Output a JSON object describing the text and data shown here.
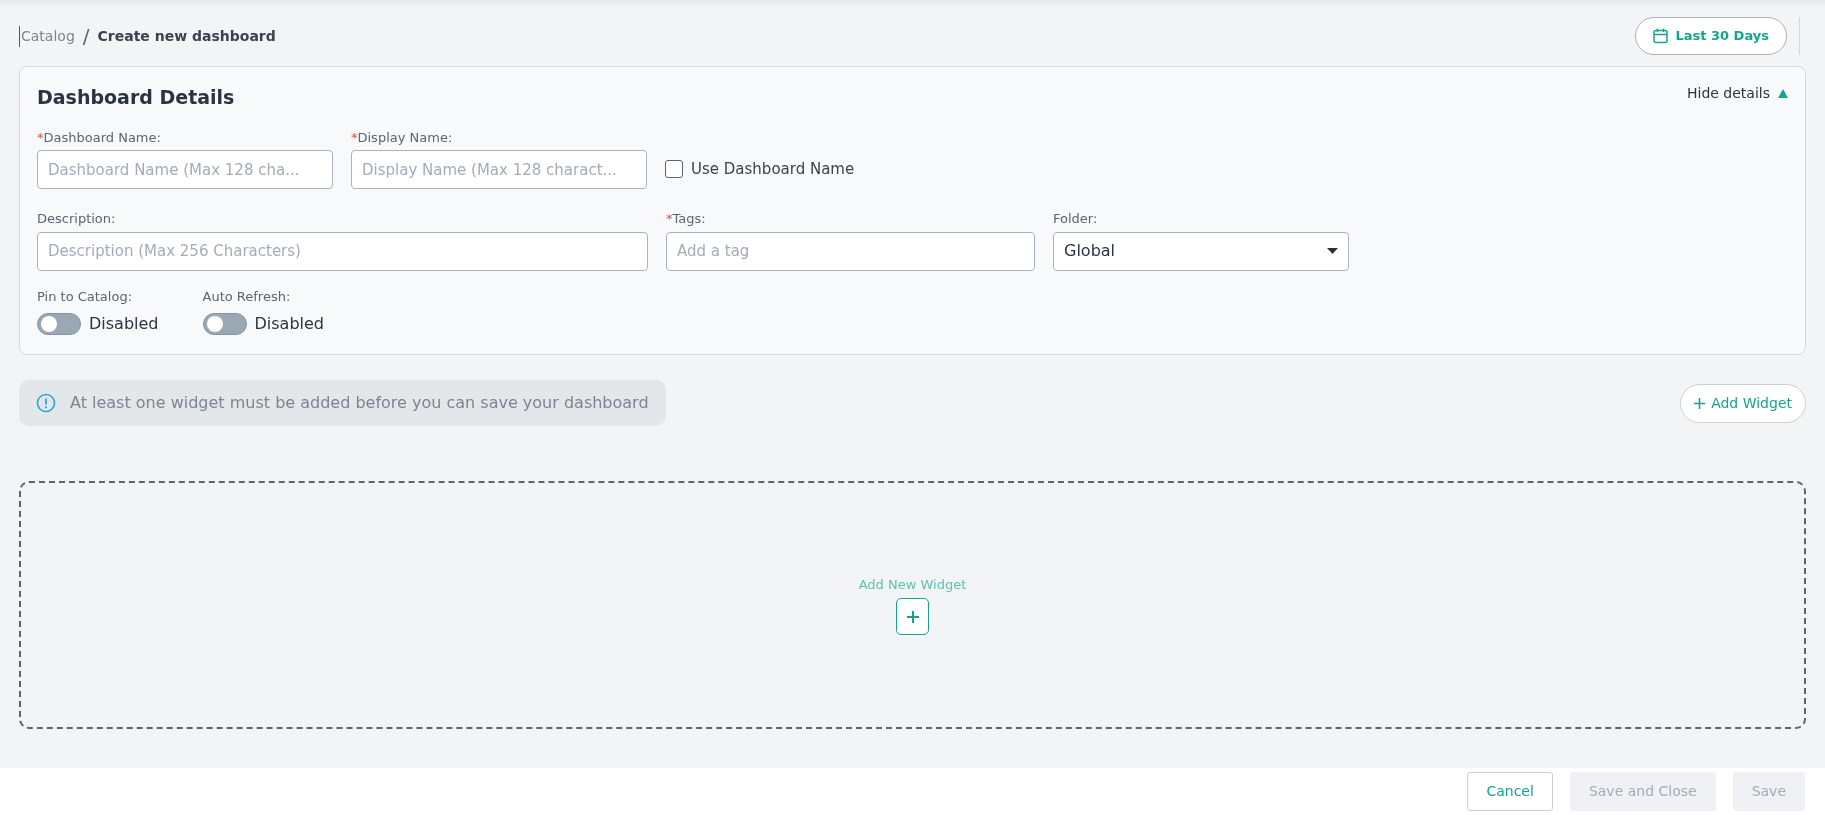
{
  "breadcrumb": [
    {
      "label": "Catalog",
      "current": false
    },
    {
      "label": "Create new dashboard",
      "current": true
    }
  ],
  "breadcrumb_separator": "/",
  "date_range": {
    "label": "Last 30 Days"
  },
  "details": {
    "title": "Dashboard Details",
    "toggle_label": "Hide details",
    "expanded": true,
    "fields": [
      {
        "kind": "input",
        "required_mark": "*",
        "label": "Dashboard Name:",
        "placeholder": "Dashboard Name (Max 128 cha..."
      },
      {
        "kind": "input",
        "required_mark": "*",
        "label": "Display Name:",
        "placeholder": "Display Name (Max 128 charact..."
      },
      {
        "kind": "checkbox",
        "label": "Use Dashboard Name",
        "checked": false
      },
      {
        "kind": "input",
        "label": "Description:",
        "placeholder": "Description (Max 256 Characters)"
      },
      {
        "kind": "input",
        "required_mark": "*",
        "label": "Tags:",
        "placeholder": "Add a tag"
      },
      {
        "kind": "select",
        "label": "Folder:",
        "value": "Global"
      }
    ],
    "switches": [
      {
        "label": "Pin to Catalog:",
        "on": false,
        "state_text": "Disabled"
      },
      {
        "label": "Auto Refresh:",
        "on": false,
        "state_text": "Disabled"
      }
    ]
  },
  "notice": "At least one widget must be added before you can save your dashboard",
  "add_widget_button": "Add Widget",
  "drop_zone": {
    "label": "Add New Widget"
  },
  "footer_buttons": [
    {
      "label": "Cancel",
      "disabled": false
    },
    {
      "label": "Save and Close",
      "disabled": true
    },
    {
      "label": "Save",
      "disabled": true
    }
  ]
}
